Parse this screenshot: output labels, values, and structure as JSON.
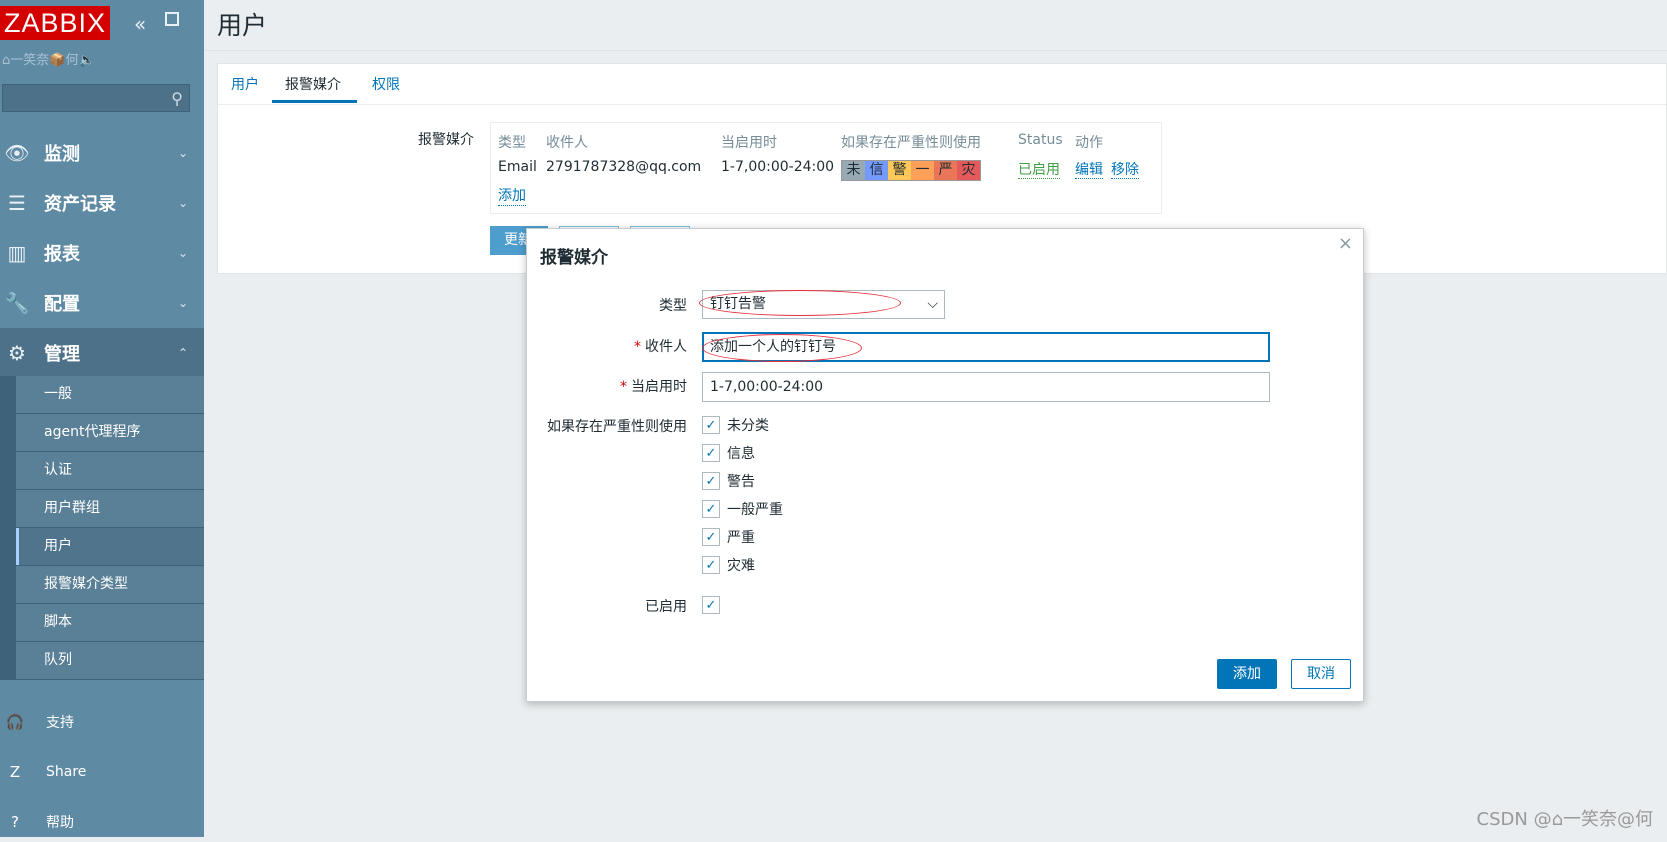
{
  "sidebar": {
    "logo": "ZABBIX",
    "user_line": "⌂一笑奈📦何🔈",
    "nav": [
      {
        "label": "监测",
        "icon": "eye-icon",
        "glyph": "👁",
        "chevron": "⌄"
      },
      {
        "label": "资产记录",
        "icon": "list-icon",
        "glyph": "☰",
        "chevron": "⌄"
      },
      {
        "label": "报表",
        "icon": "bar-chart-icon",
        "glyph": "▥",
        "chevron": "⌄"
      },
      {
        "label": "配置",
        "icon": "wrench-icon",
        "glyph": "🔧",
        "chevron": "⌄"
      },
      {
        "label": "管理",
        "icon": "gear-icon",
        "glyph": "⚙",
        "chevron": "⌃"
      }
    ],
    "submenu": [
      "一般",
      "agent代理程序",
      "认证",
      "用户群组",
      "用户",
      "报警媒介类型",
      "脚本",
      "队列"
    ],
    "bottom": [
      {
        "label": "支持",
        "icon": "headset-icon",
        "glyph": "🎧"
      },
      {
        "label": "Share",
        "icon": "share-z-icon",
        "glyph": "Z"
      },
      {
        "label": "帮助",
        "icon": "help-icon",
        "glyph": "?"
      }
    ]
  },
  "page": {
    "title": "用户",
    "tabs": [
      "用户",
      "报警媒介",
      "权限"
    ],
    "media_label": "报警媒介",
    "table": {
      "headers": [
        "类型",
        "收件人",
        "当启用时",
        "如果存在严重性则使用",
        "Status",
        "动作"
      ],
      "row": {
        "type": "Email",
        "recipient": "2791787328@qq.com",
        "when_active": "1-7,00:00-24:00",
        "severities": [
          "未",
          "信",
          "警",
          "一",
          "严",
          "灾"
        ],
        "status": "已启用",
        "edit": "编辑",
        "remove": "移除"
      },
      "add": "添加"
    },
    "update_button": "更新"
  },
  "dialog": {
    "title": "报警媒介",
    "close": "×",
    "type_label": "类型",
    "type_value": "钉钉告警",
    "recipient_label": "收件人",
    "recipient_value": "添加一个人的钉钉号",
    "when_label": "当启用时",
    "when_value": "1-7,00:00-24:00",
    "severity_label": "如果存在严重性则使用",
    "severities": [
      "未分类",
      "信息",
      "警告",
      "一般严重",
      "严重",
      "灾难"
    ],
    "enabled_label": "已启用",
    "add_button": "添加",
    "cancel_button": "取消"
  },
  "colors": {
    "sidebar": "#5f8aa4",
    "accent": "#0275b8",
    "logo_bg": "#d40000",
    "sev_not_classified": "#97aab3",
    "sev_information": "#7499ff",
    "sev_warning": "#ffc859",
    "sev_average": "#ffa059",
    "sev_high": "#e97659",
    "sev_disaster": "#e45959"
  },
  "watermark": "CSDN @⌂一笑奈@何"
}
